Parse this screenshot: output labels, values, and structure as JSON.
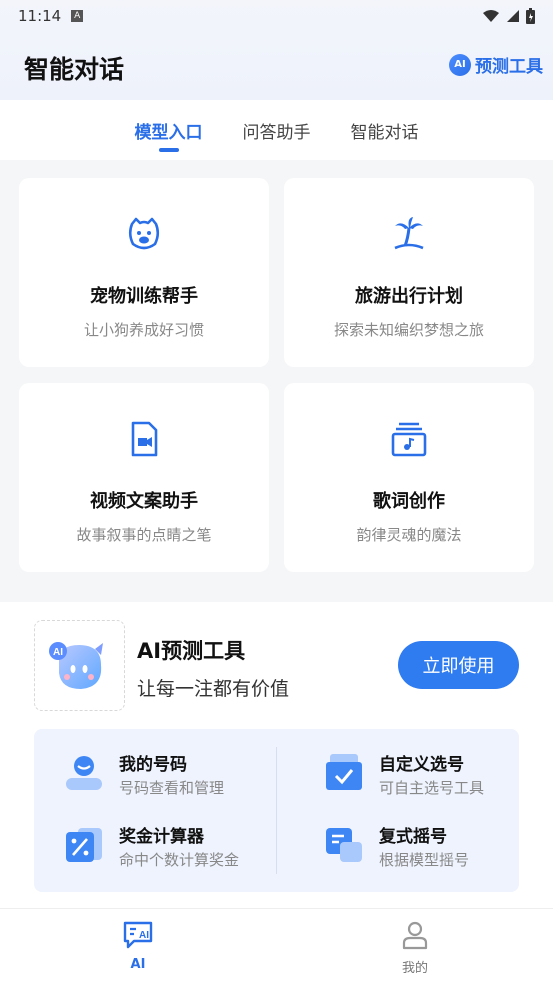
{
  "status_bar": {
    "time": "11:14",
    "notif": "A"
  },
  "header": {
    "title": "智能对话",
    "predict_label": "预测工具",
    "ai_badge": "AI"
  },
  "tabs": [
    {
      "label": "模型入口",
      "active": true
    },
    {
      "label": "问答助手",
      "active": false
    },
    {
      "label": "智能对话",
      "active": false
    }
  ],
  "cards": [
    {
      "title": "宠物训练帮手",
      "subtitle": "让小狗养成好习惯",
      "icon": "dog-icon"
    },
    {
      "title": "旅游出行计划",
      "subtitle": "探索未知编织梦想之旅",
      "icon": "palm-tree-icon"
    },
    {
      "title": "视频文案助手",
      "subtitle": "故事叙事的点睛之笔",
      "icon": "video-file-icon"
    },
    {
      "title": "歌词创作",
      "subtitle": "韵律灵魂的魔法",
      "icon": "music-box-icon"
    }
  ],
  "promo": {
    "title": "AI预测工具",
    "subtitle": "让每一注都有价值",
    "button": "立即使用",
    "avatar_badge": "AI"
  },
  "tools": [
    {
      "title": "我的号码",
      "subtitle": "号码查看和管理",
      "icon": "user-number-icon"
    },
    {
      "title": "自定义选号",
      "subtitle": "可自主选号工具",
      "icon": "custom-pick-icon"
    },
    {
      "title": "奖金计算器",
      "subtitle": "命中个数计算奖金",
      "icon": "calculator-icon"
    },
    {
      "title": "复式摇号",
      "subtitle": "根据模型摇号",
      "icon": "compound-draw-icon"
    }
  ],
  "bottom_nav": [
    {
      "label": "AI",
      "active": true,
      "icon": "ai-chat-icon"
    },
    {
      "label": "我的",
      "active": false,
      "icon": "profile-icon"
    }
  ],
  "colors": {
    "accent": "#2a6fe8",
    "button": "#2f7bf0",
    "tool_bg": "#eef3fe"
  }
}
